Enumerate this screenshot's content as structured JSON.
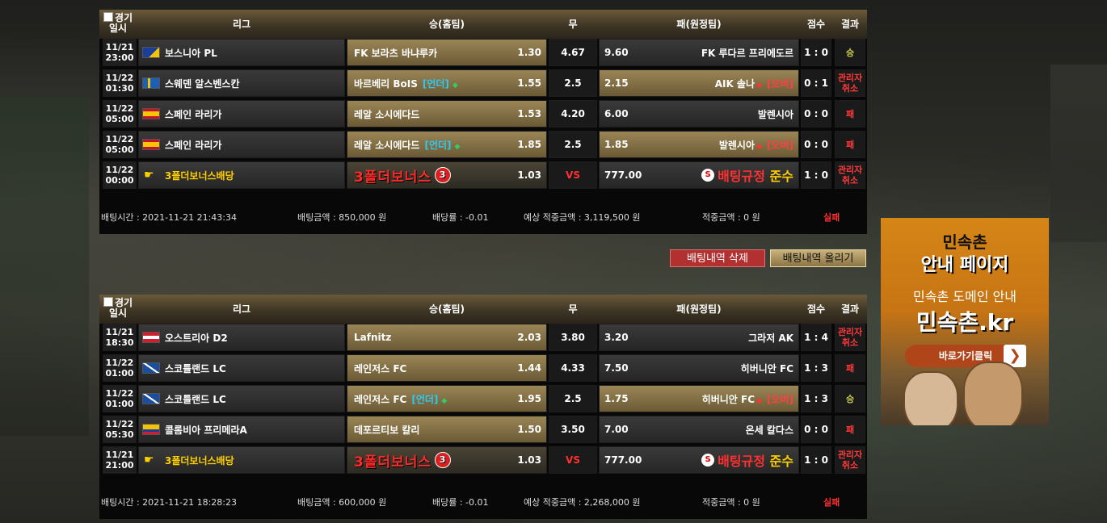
{
  "colors": {
    "accent_gold": "#9a8556",
    "lose_red": "#ff3a3a",
    "win_yellow": "#c8c850",
    "under_cyan": "#2ecaf0"
  },
  "headers": {
    "check_label": "경기",
    "date": "일시",
    "league": "리그",
    "home": "승(홈팀)",
    "draw": "무",
    "away": "패(원정팀)",
    "score": "점수",
    "result": "결과"
  },
  "slips": [
    {
      "rows": [
        {
          "date": "11/21",
          "time": "23:00",
          "flag": "bosnia-flag",
          "league": "보스니아 PL",
          "home": "FK 보라츠 바냐루카",
          "home_odds": "1.30",
          "draw": "4.67",
          "away_odds": "9.60",
          "away": "FK 루다르 프리에도르",
          "score": "1 : 0",
          "result": "승"
        },
        {
          "date": "11/22",
          "time": "01:30",
          "flag": "sweden-flag",
          "league": "스웨덴 알스벤스칸",
          "home": "바르베리 BoIS",
          "home_tag": "[언더]",
          "home_odds": "1.55",
          "draw": "2.5",
          "away_odds": "2.15",
          "away": "AIK 솔나",
          "away_tag": "[오버]",
          "score": "0 : 1",
          "result": "관리자취소"
        },
        {
          "date": "11/22",
          "time": "05:00",
          "flag": "spain-flag",
          "league": "스페인 라리가",
          "home": "레알 소시에다드",
          "home_odds": "1.53",
          "draw": "4.20",
          "away_odds": "6.00",
          "away": "발렌시아",
          "score": "0 : 0",
          "result": "패"
        },
        {
          "date": "11/22",
          "time": "05:00",
          "flag": "spain-flag",
          "league": "스페인 라리가",
          "home": "레알 소시에다드",
          "home_tag": "[언더]",
          "home_odds": "1.85",
          "draw": "2.5",
          "away_odds": "1.85",
          "away": "발렌시아",
          "away_tag": "[오버]",
          "score": "0 : 0",
          "result": "패"
        },
        {
          "date": "11/22",
          "time": "00:00",
          "flag": "bonus-icon",
          "league": "3폴더보너스배당",
          "home": "3폴더보너스",
          "home_num": "3",
          "home_odds": "1.03",
          "draw": "VS",
          "away_odds": "777.00",
          "away_rule_1": "배팅규정",
          "away_rule_2": "준수",
          "score": "1 : 0",
          "result": "관리자취소"
        }
      ],
      "summary": {
        "bet_time": "배팅시간 : 2021-11-21 21:43:34",
        "amount": "배팅금액 : 850,000 원",
        "rate": "배당률 : -0.01",
        "expected": "예상 적중금액 : 3,119,500 원",
        "hit": "적중금액 : 0 원",
        "status": "실패"
      }
    },
    {
      "rows": [
        {
          "date": "11/21",
          "time": "18:30",
          "flag": "austria-flag",
          "league": "오스트리아 D2",
          "home": "Lafnitz",
          "home_odds": "2.03",
          "draw": "3.80",
          "away_odds": "3.20",
          "away": "그라저 AK",
          "score": "1 : 4",
          "result": "관리자취소"
        },
        {
          "date": "11/22",
          "time": "01:00",
          "flag": "scotland-flag",
          "league": "스코틀랜드 LC",
          "home": "레인저스 FC",
          "home_odds": "1.44",
          "draw": "4.33",
          "away_odds": "7.50",
          "away": "히버니안 FC",
          "score": "1 : 3",
          "result": "패"
        },
        {
          "date": "11/22",
          "time": "01:00",
          "flag": "scotland-flag",
          "league": "스코틀랜드 LC",
          "home": "레인저스 FC",
          "home_tag": "[언더]",
          "home_odds": "1.95",
          "draw": "2.5",
          "away_odds": "1.75",
          "away": "히버니안 FC",
          "away_tag": "[오버]",
          "score": "1 : 3",
          "result": "승"
        },
        {
          "date": "11/22",
          "time": "05:30",
          "flag": "colombia-flag",
          "league": "콜롬비아 프리메라A",
          "home": "데포르티보 칼리",
          "home_odds": "1.50",
          "draw": "3.50",
          "away_odds": "7.00",
          "away": "온세 칼다스",
          "score": "0 : 0",
          "result": "패"
        },
        {
          "date": "11/21",
          "time": "21:00",
          "flag": "bonus-icon",
          "league": "3폴더보너스배당",
          "home": "3폴더보너스",
          "home_num": "3",
          "home_odds": "1.03",
          "draw": "VS",
          "away_odds": "777.00",
          "away_rule_1": "배팅규정",
          "away_rule_2": "준수",
          "score": "1 : 0",
          "result": "관리자취소"
        }
      ],
      "summary": {
        "bet_time": "배팅시간 : 2021-11-21 18:28:23",
        "amount": "배팅금액 : 600,000 원",
        "rate": "배당률 : -0.01",
        "expected": "예상 적중금액 : 2,268,000 원",
        "hit": "적중금액 : 0 원",
        "status": "실패"
      }
    }
  ],
  "buttons": {
    "delete": "배팅내역 삭제",
    "upload": "배팅내역 올리기"
  },
  "ad": {
    "title": "민속촌",
    "subtitle": "안내 페이지",
    "line": "민속촌 도메인 안내",
    "domain": "민속촌.kr",
    "cta": "바로가기클릭"
  }
}
